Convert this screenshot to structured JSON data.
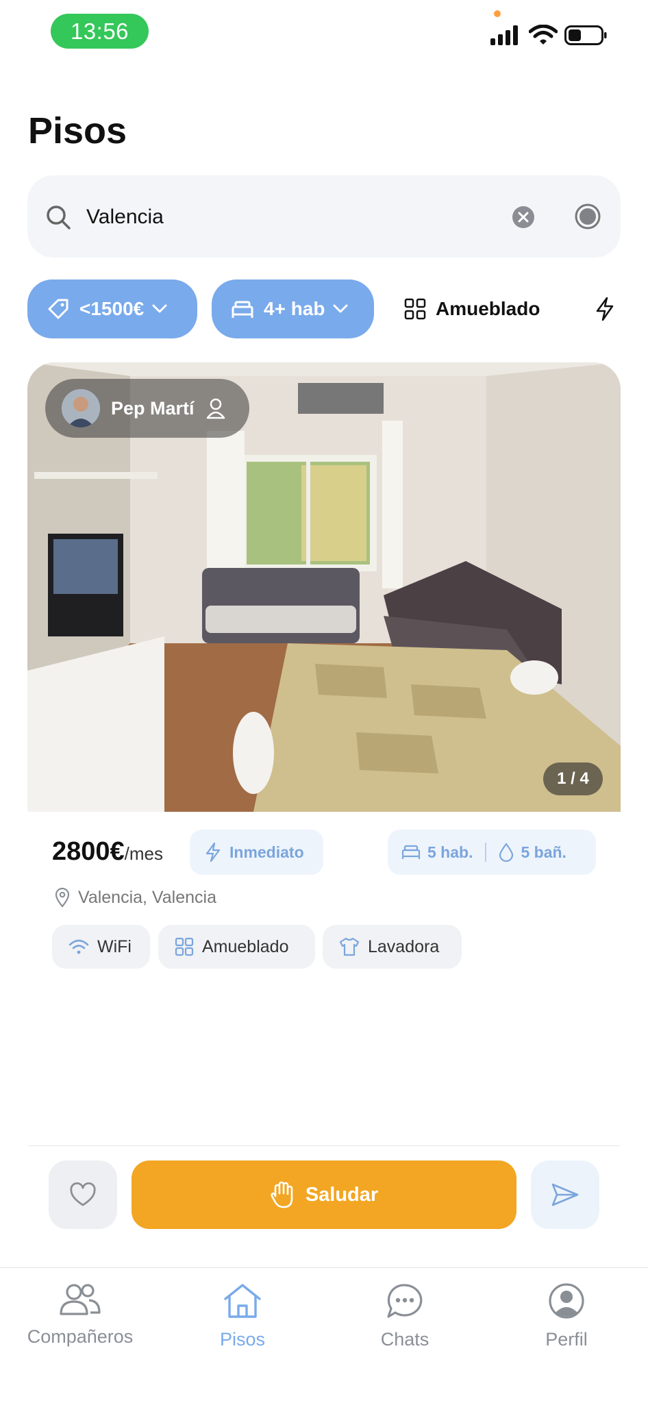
{
  "status_bar": {
    "time": "13:56"
  },
  "page": {
    "title": "Pisos"
  },
  "search": {
    "value": "Valencia",
    "placeholder": ""
  },
  "filters": [
    {
      "label": "<1500€",
      "icon": "tag-icon"
    },
    {
      "label": "4+ hab",
      "icon": "bed-icon"
    },
    {
      "label": "Amueblado",
      "icon": "grid-icon"
    },
    {
      "icon": "lightning-icon"
    }
  ],
  "listing": {
    "owner_name": "Pep Martí",
    "photo_counter": "1 / 4",
    "price": "2800€",
    "price_unit": "/mes",
    "availability": "Inmediato",
    "rooms": "5 hab.",
    "baths": "5 bañ.",
    "location": "Valencia, Valencia",
    "amenities": [
      {
        "label": "WiFi",
        "icon": "wifi-icon"
      },
      {
        "label": "Amueblado",
        "icon": "grid-icon"
      },
      {
        "label": "Lavadora",
        "icon": "shirt-icon"
      }
    ]
  },
  "actions": {
    "greet_label": "Saludar"
  },
  "tabs": [
    {
      "label": "Compañeros",
      "icon": "people-icon"
    },
    {
      "label": "Pisos",
      "icon": "house-icon",
      "active": true
    },
    {
      "label": "Chats",
      "icon": "chat-icon"
    },
    {
      "label": "Perfil",
      "icon": "profile-icon"
    }
  ],
  "colors": {
    "accent": "#79aaeb",
    "greet": "#f2a623",
    "status_time_bg": "#34c759"
  }
}
